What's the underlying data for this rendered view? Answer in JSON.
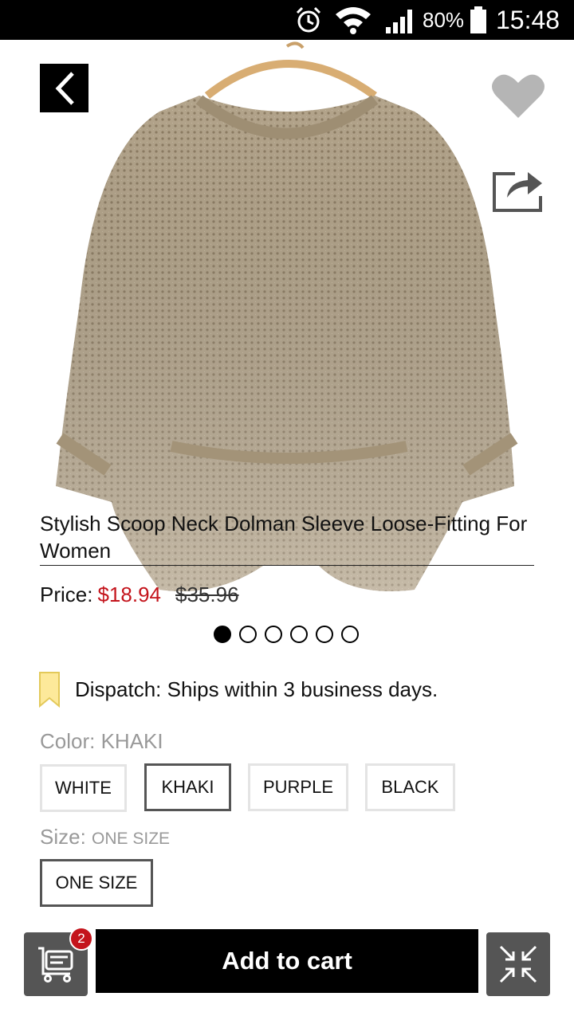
{
  "status_bar": {
    "alarm_icon": "alarm-clock-icon",
    "wifi_icon": "wifi-icon",
    "signal_icon": "cell-signal-icon",
    "battery_percent": "80%",
    "time": "15:48"
  },
  "product": {
    "image_description_icon": "sweater-photo",
    "title": "Stylish Scoop Neck Dolman Sleeve Loose-Fitting For Women",
    "price_label": "Price:",
    "sale_price": "$18.94",
    "original_price": "$35.96",
    "image_count": 6,
    "current_image": 1
  },
  "dispatch": {
    "icon": "bookmark-icon",
    "text": "Dispatch: Ships within 3 business days."
  },
  "color": {
    "label": "Color: KHAKI",
    "options": [
      "WHITE",
      "KHAKI",
      "PURPLE",
      "BLACK"
    ],
    "selected": "KHAKI"
  },
  "size": {
    "label": "Size: ",
    "value": "ONE SIZE",
    "options": [
      "ONE SIZE"
    ],
    "selected": "ONE SIZE"
  },
  "bottom_bar": {
    "cart_badge": "2",
    "add_to_cart": "Add to cart"
  },
  "colors": {
    "sale_red": "#c4141c",
    "badge_red": "#c4141c",
    "heart_grey": "#b5b5b5",
    "dispatch_yellow": "#fde99a",
    "button_grey": "#555555",
    "sweater_khaki": "#b3a48b"
  }
}
